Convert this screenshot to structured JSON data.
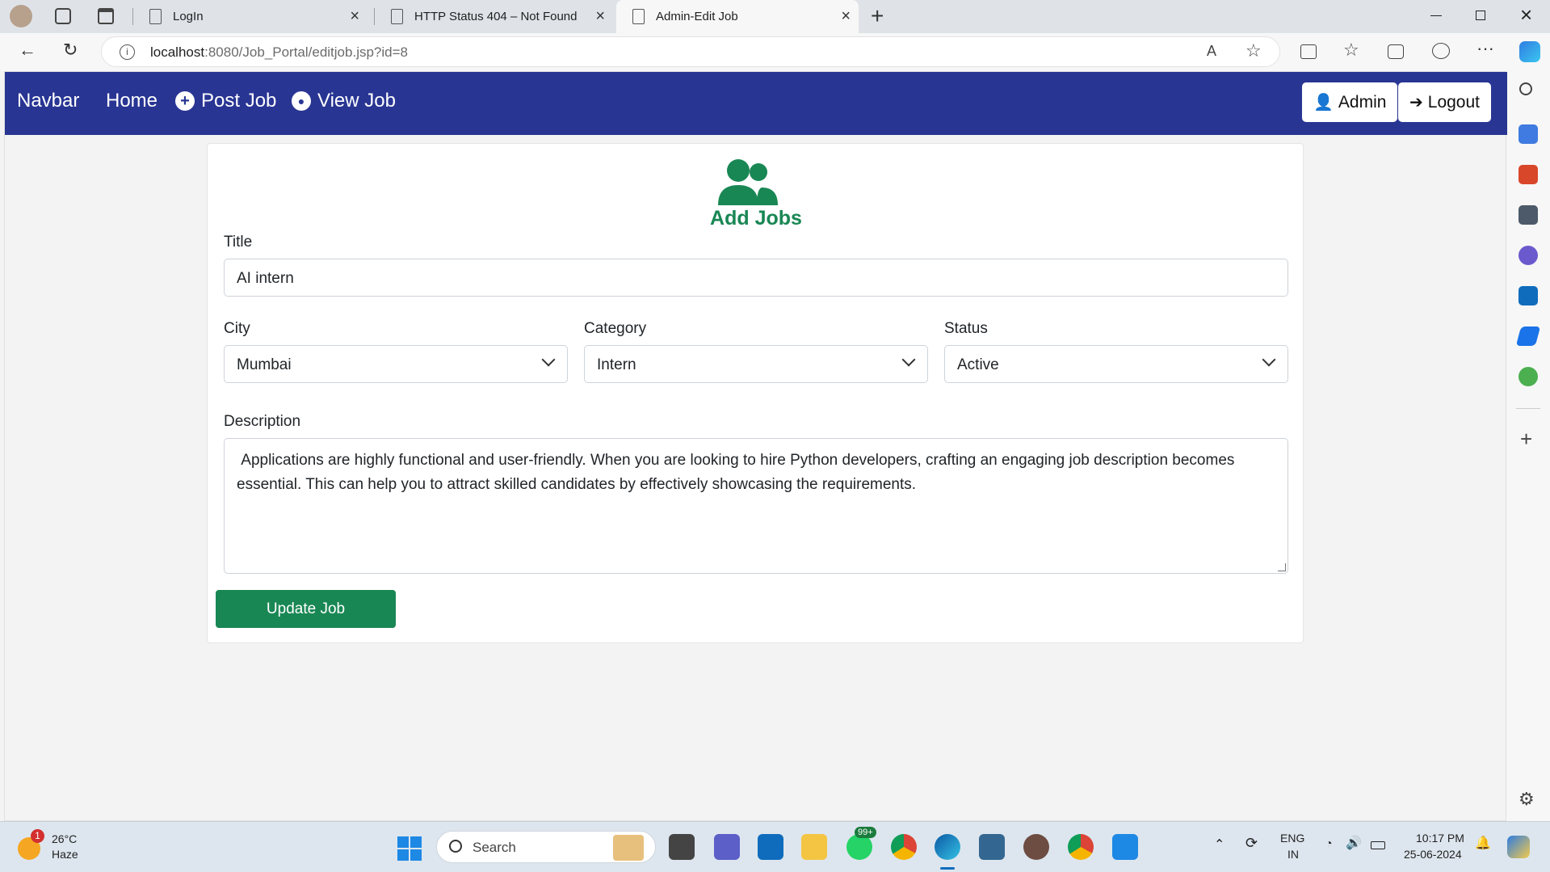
{
  "browser": {
    "tabs": [
      {
        "label": "LogIn"
      },
      {
        "label": "HTTP Status 404 – Not Found"
      },
      {
        "label": "Admin-Edit Job"
      }
    ],
    "url_host": "localhost",
    "url_rest": ":8080/Job_Portal/editjob.jsp?id=8"
  },
  "navbar": {
    "brand": "Navbar",
    "home": "Home",
    "post_job": "Post Job",
    "view_job": "View Job",
    "admin": "Admin",
    "logout": "Logout",
    "color": "#283593"
  },
  "form": {
    "heading": "Add Jobs",
    "title_label": "Title",
    "title_value": "AI intern",
    "city_label": "City",
    "city_value": "Mumbai",
    "category_label": "Category",
    "category_value": "Intern",
    "status_label": "Status",
    "status_value": "Active",
    "description_label": "Description",
    "description_value": " Applications are highly functional and user-friendly. When you are looking to hire Python developers, crafting an engaging job description becomes essential. This can help you to attract skilled candidates by effectively showcasing the requirements.",
    "submit_label": "Update Job",
    "accent": "#198754"
  },
  "taskbar": {
    "weather_temp": "26°C",
    "weather_desc": "Haze",
    "weather_badge": "1",
    "search_placeholder": "Search",
    "whatsapp_badge": "99+",
    "lang_top": "ENG",
    "lang_bottom": "IN",
    "time": "10:17 PM",
    "date": "25-06-2024"
  }
}
